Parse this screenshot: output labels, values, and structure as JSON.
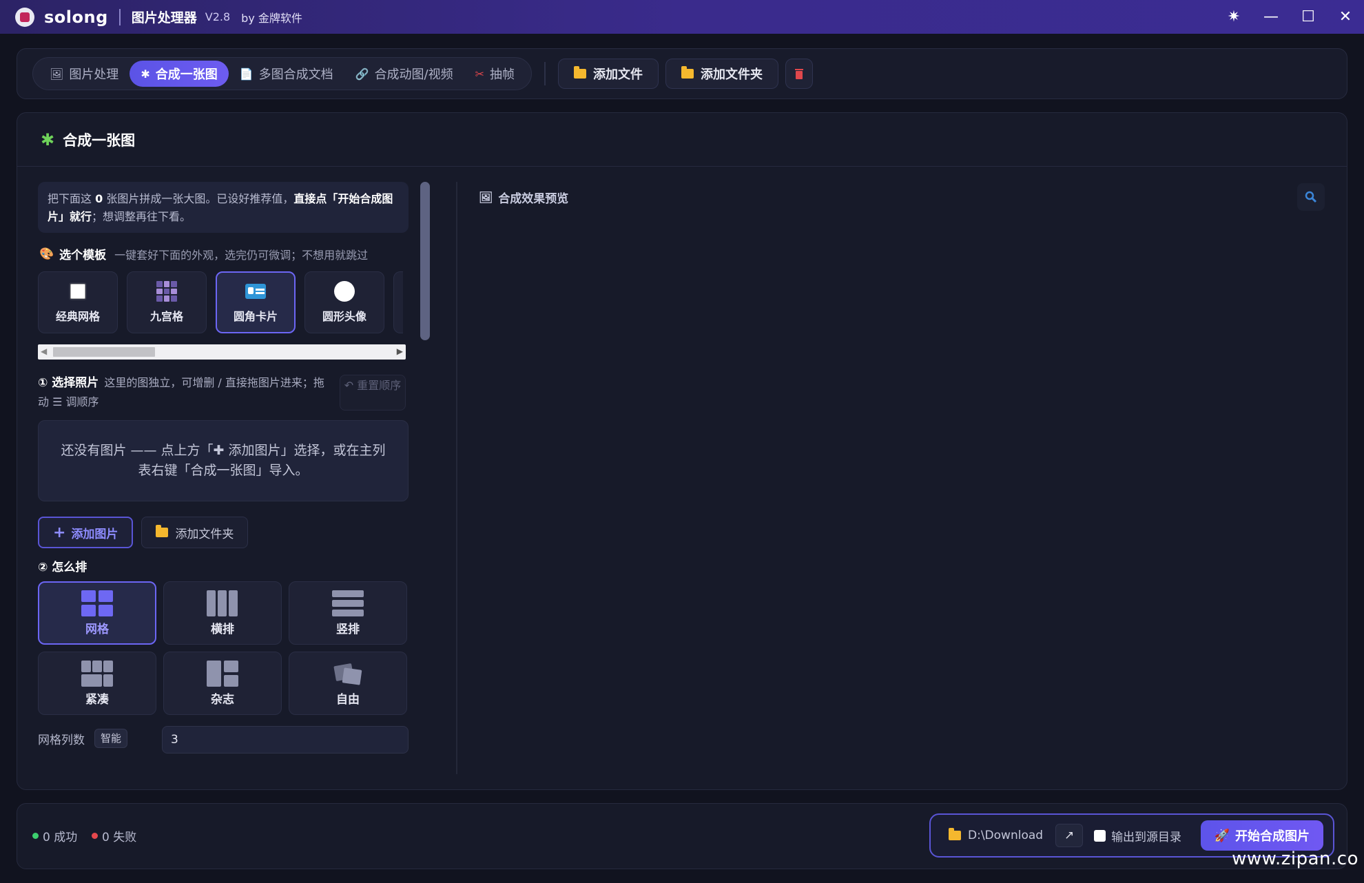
{
  "titlebar": {
    "app_name": "solong",
    "title": "图片处理器",
    "version": "V2.8",
    "author": "by 金牌软件",
    "controls": [
      "✷",
      "—",
      "☐",
      "✕"
    ]
  },
  "toolbar": {
    "tabs": [
      {
        "icon": "🖼",
        "label": "图片处理"
      },
      {
        "icon": "✱",
        "label": "合成一张图"
      },
      {
        "icon": "📄",
        "label": "多图合成文档"
      },
      {
        "icon": "🔗",
        "label": "合成动图/视频"
      },
      {
        "icon": "✂",
        "label": "抽帧"
      }
    ],
    "active_tab": "合成一张图",
    "add_file": "添加文件",
    "add_folder": "添加文件夹",
    "trash_icon": "trash-icon"
  },
  "panel": {
    "title": "合成一张图",
    "info_pre": "把下面这 ",
    "info_count": "0",
    "info_mid": " 张图片拼成一张大图。已设好推荐值，",
    "info_bold": "直接点「开始合成图片」就行",
    "info_post": "；想调整再往下看。",
    "template_title": "选个模板",
    "template_hint": "一键套好下面的外观，选完仍可微调；不想用就跳过",
    "templates": [
      {
        "label": "经典网格",
        "icon": "white-square-icon"
      },
      {
        "label": "九宫格",
        "icon": "nine-grid-icon"
      },
      {
        "label": "圆角卡片",
        "icon": "id-card-icon"
      },
      {
        "label": "圆形头像",
        "icon": "white-circle-icon"
      }
    ],
    "active_template": "圆角卡片",
    "step1_title": "① 选择照片",
    "step1_hint": "这里的图独立，可增删 / 直接拖图片进来；拖动 ☰ 调顺序",
    "reset_label": "↶ 重置顺序",
    "empty_text": "还没有图片 —— 点上方「✚ 添加图片」选择，或在主列表右键「合成一张图」导入。",
    "add_images": "添加图片",
    "add_folder": "添加文件夹",
    "step2_title": "② 怎么排",
    "layouts": [
      {
        "label": "网格",
        "icon": "grid-icon"
      },
      {
        "label": "横排",
        "icon": "columns-icon"
      },
      {
        "label": "竖排",
        "icon": "rows-icon"
      },
      {
        "label": "紧凑",
        "icon": "compact-icon"
      },
      {
        "label": "杂志",
        "icon": "magazine-icon"
      },
      {
        "label": "自由",
        "icon": "free-icon"
      }
    ],
    "active_layout": "网格",
    "cols_label": "网格列数",
    "smart_tag": "智能",
    "cols_value": "3",
    "preview_title": "合成效果预览"
  },
  "status": {
    "success": "0 成功",
    "fail": "0 失败",
    "success_color": "#3ccf6e",
    "fail_color": "#e5484d"
  },
  "output": {
    "path": "D:\\Download",
    "open_icon": "↗",
    "to_source": "输出到源目录",
    "start": "开始合成图片"
  },
  "watermark": "www.zipan.co"
}
